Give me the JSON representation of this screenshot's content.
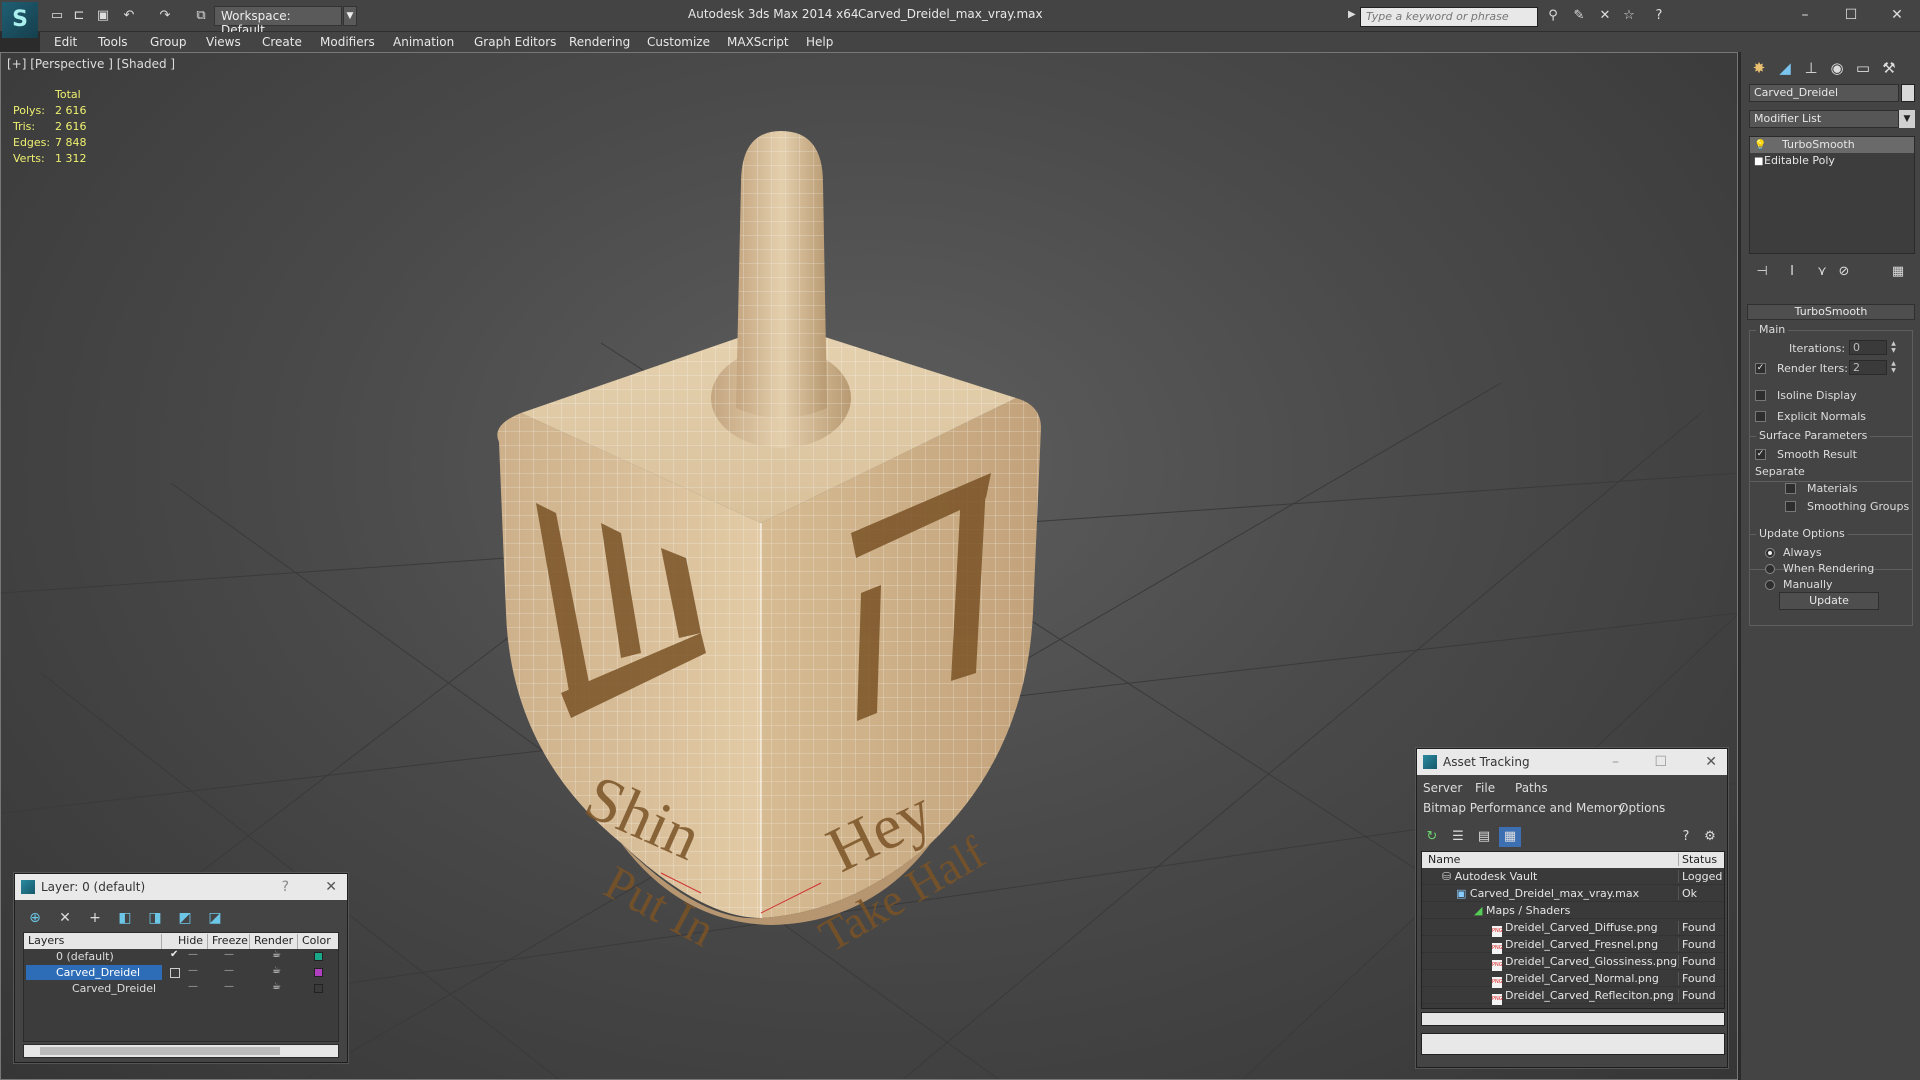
{
  "titlebar": {
    "workspace": "Workspace: Default",
    "app_title": "Autodesk 3ds Max  2014 x64",
    "file_title": "Carved_Dreidel_max_vray.max",
    "search_placeholder": "Type a keyword or phrase"
  },
  "menu": [
    "Edit",
    "Tools",
    "Group",
    "Views",
    "Create",
    "Modifiers",
    "Animation",
    "Graph Editors",
    "Rendering",
    "Customize",
    "MAXScript",
    "Help"
  ],
  "viewport": {
    "label": "[+] [Perspective ] [Shaded ]",
    "stats": {
      "header": "Total",
      "polys_label": "Polys:",
      "polys": "2 616",
      "tris_label": "Tris:",
      "tris": "2 616",
      "edges_label": "Edges:",
      "edges": "7 848",
      "verts_label": "Verts:",
      "verts": "1 312"
    },
    "face_left_word1": "Shin",
    "face_left_word2": "Put In",
    "face_right_word1": "Hey",
    "face_right_word2": "Take Half"
  },
  "command_panel": {
    "object_name": "Carved_Dreidel",
    "modifier_list": "Modifier List",
    "stack": [
      "TurboSmooth",
      "Editable Poly"
    ],
    "rollout_title": "TurboSmooth",
    "main_group": "Main",
    "iterations_label": "Iterations:",
    "iterations_value": "0",
    "render_iters_label": "Render Iters:",
    "render_iters_value": "2",
    "isoline_label": "Isoline Display",
    "explicit_normals_label": "Explicit Normals",
    "surface_group": "Surface Parameters",
    "smooth_result_label": "Smooth Result",
    "separate_label": "Separate",
    "materials_label": "Materials",
    "smoothing_groups_label": "Smoothing Groups",
    "update_group": "Update Options",
    "always_label": "Always",
    "when_rendering_label": "When Rendering",
    "manually_label": "Manually",
    "update_button": "Update",
    "checks": {
      "render_iters": true,
      "isoline": false,
      "explicit_normals": false,
      "smooth_result": true,
      "materials": false,
      "smoothing_groups": false
    },
    "update_mode": "Always"
  },
  "layer_panel": {
    "title": "Layer: 0 (default)",
    "help": "?",
    "columns": [
      "Layers",
      "Hide",
      "Freeze",
      "Render",
      "Color"
    ],
    "rows": [
      {
        "name": "0 (default)",
        "color": "#1aa88a"
      },
      {
        "name": "Carved_Dreidel",
        "color": "#b040c0"
      },
      {
        "name": "Carved_Dreidel",
        "color": "#3a3a3a"
      }
    ]
  },
  "asset_panel": {
    "title": "Asset Tracking",
    "menu": [
      "Server",
      "File",
      "Paths"
    ],
    "menu2": [
      "Bitmap Performance and Memory",
      "Options"
    ],
    "columns": [
      "Name",
      "Status"
    ],
    "rows": [
      {
        "name": "Autodesk Vault",
        "status": "Logged Out",
        "indent": 1
      },
      {
        "name": "Carved_Dreidel_max_vray.max",
        "status": "Ok",
        "indent": 2
      },
      {
        "name": "Maps / Shaders",
        "status": "",
        "indent": 3
      },
      {
        "name": "Dreidel_Carved_Diffuse.png",
        "status": "Found",
        "indent": 4
      },
      {
        "name": "Dreidel_Carved_Fresnel.png",
        "status": "Found",
        "indent": 4
      },
      {
        "name": "Dreidel_Carved_Glossiness.png",
        "status": "Found",
        "indent": 4
      },
      {
        "name": "Dreidel_Carved_Normal.png",
        "status": "Found",
        "indent": 4
      },
      {
        "name": "Dreidel_Carved_Refleciton.png",
        "status": "Found",
        "indent": 4
      }
    ]
  }
}
